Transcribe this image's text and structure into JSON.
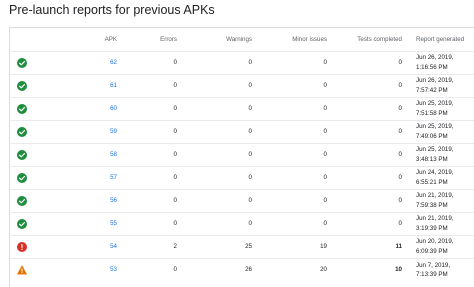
{
  "title": "Pre-launch reports for previous APKs",
  "columns": {
    "apk": "APK",
    "errors": "Errors",
    "warnings": "Warnings",
    "minor_issues": "Minor issues",
    "tests_completed": "Tests completed",
    "report_generated": "Report generated"
  },
  "status_colors": {
    "success": "#1e8e3e",
    "error": "#d93025",
    "warning": "#e37400"
  },
  "rows": [
    {
      "status": "success",
      "status_icon": "check-circle-icon",
      "apk": "62",
      "errors": "0",
      "warnings": "0",
      "minor_issues": "0",
      "tests_completed": "0",
      "date": "Jun 26, 2019,",
      "time": "1:16:56 PM"
    },
    {
      "status": "success",
      "status_icon": "check-circle-icon",
      "apk": "61",
      "errors": "0",
      "warnings": "0",
      "minor_issues": "0",
      "tests_completed": "0",
      "date": "Jun 26, 2019,",
      "time": "7:57:42 PM"
    },
    {
      "status": "success",
      "status_icon": "check-circle-icon",
      "apk": "60",
      "errors": "0",
      "warnings": "0",
      "minor_issues": "0",
      "tests_completed": "0",
      "date": "Jun 25, 2019,",
      "time": "7:51:58 PM"
    },
    {
      "status": "success",
      "status_icon": "check-circle-icon",
      "apk": "59",
      "errors": "0",
      "warnings": "0",
      "minor_issues": "0",
      "tests_completed": "0",
      "date": "Jun 25, 2019,",
      "time": "7:49:06 PM"
    },
    {
      "status": "success",
      "status_icon": "check-circle-icon",
      "apk": "58",
      "errors": "0",
      "warnings": "0",
      "minor_issues": "0",
      "tests_completed": "0",
      "date": "Jun 25, 2019,",
      "time": "3:48:13 PM"
    },
    {
      "status": "success",
      "status_icon": "check-circle-icon",
      "apk": "57",
      "errors": "0",
      "warnings": "0",
      "minor_issues": "0",
      "tests_completed": "0",
      "date": "Jun 24, 2019,",
      "time": "6:55:21 PM"
    },
    {
      "status": "success",
      "status_icon": "check-circle-icon",
      "apk": "56",
      "errors": "0",
      "warnings": "0",
      "minor_issues": "0",
      "tests_completed": "0",
      "date": "Jun 21, 2019,",
      "time": "7:59:38 PM"
    },
    {
      "status": "success",
      "status_icon": "check-circle-icon",
      "apk": "55",
      "errors": "0",
      "warnings": "0",
      "minor_issues": "0",
      "tests_completed": "0",
      "date": "Jun 21, 2019,",
      "time": "3:19:39 PM"
    },
    {
      "status": "error",
      "status_icon": "error-icon",
      "apk": "54",
      "errors": "2",
      "warnings": "25",
      "minor_issues": "19",
      "tests_completed": "11",
      "date": "Jun 20, 2019,",
      "time": "6:09:39 PM"
    },
    {
      "status": "warning",
      "status_icon": "warning-icon",
      "apk": "53",
      "errors": "0",
      "warnings": "26",
      "minor_issues": "20",
      "tests_completed": "10",
      "date": "Jun 7, 2019,",
      "time": "7:13:39 PM"
    }
  ]
}
